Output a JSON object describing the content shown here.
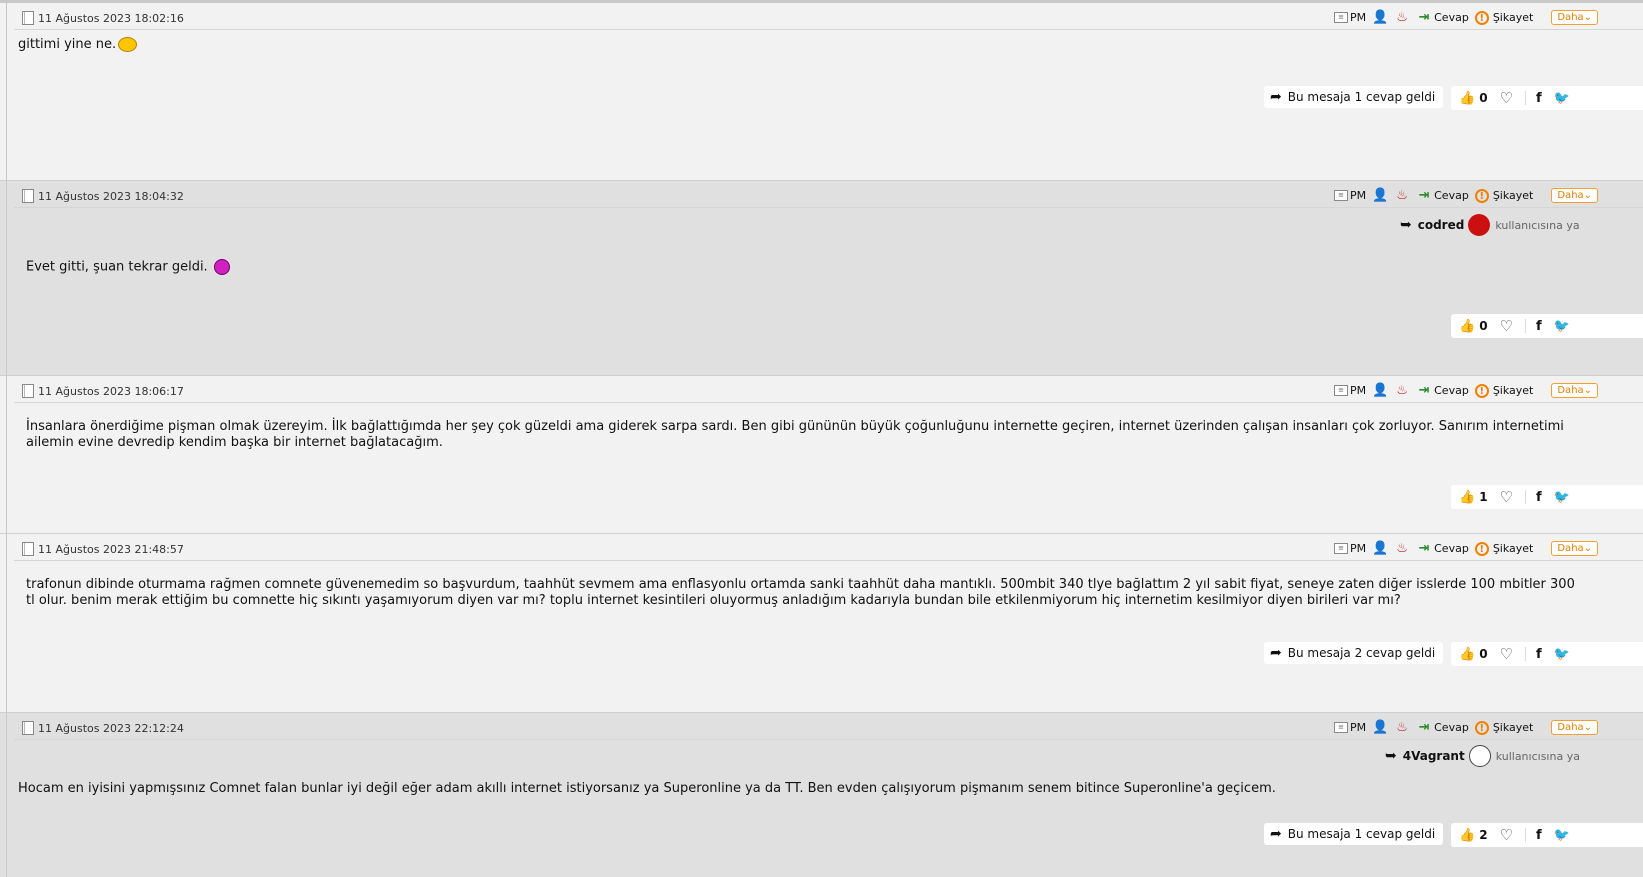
{
  "actions": {
    "pm": "PM",
    "reply": "Cevap",
    "report": "Şikayet",
    "more": "Daha"
  },
  "quote_suffix": "kullanıcısına ya",
  "posts": [
    {
      "date": "11 Ağustos 2023 18:02:16",
      "body": "gittimi yine ne.",
      "replies": "Bu mesaja 1 cevap geldi",
      "likes": "0"
    },
    {
      "date": "11 Ağustos 2023 18:04:32",
      "quoted_user": "codred",
      "body": "Evet gitti, şuan tekrar geldi.",
      "likes": "0"
    },
    {
      "date": "11 Ağustos 2023 18:06:17",
      "body": "İnsanlara önerdiğime pişman olmak üzereyim. İlk bağlattığımda her şey çok güzeldi ama giderek sarpa sardı. Ben gibi gününün büyük çoğunluğunu internette geçiren, internet üzerinden çalışan insanları çok zorluyor. Sanırım internetimi ailemin evine devredip kendim başka bir internet bağlatacağım.",
      "likes": "1"
    },
    {
      "date": "11 Ağustos 2023 21:48:57",
      "body": "trafonun dibinde oturmama rağmen comnete güvenemedim so başvurdum, taahhüt sevmem ama enflasyonlu ortamda sanki taahhüt daha mantıklı. 500mbit 340 tlye bağlattım 2 yıl sabit fiyat, seneye zaten diğer isslerde 100 mbitler 300 tl olur. benim merak ettiğim bu comnette hiç sıkıntı yaşamıyorum diyen var mı? toplu internet kesintileri oluyormuş anladığım kadarıyla bundan bile etkilenmiyorum hiç internetim kesilmiyor diyen birileri var mı?",
      "replies": "Bu mesaja 2 cevap geldi",
      "likes": "0"
    },
    {
      "date": "11 Ağustos 2023 22:12:24",
      "quoted_user": "4Vagrant",
      "body": "Hocam en iyisini yapmışsınız Comnet falan bunlar iyi değil eğer adam akıllı internet istiyorsanız ya Superonline ya da TT. Ben evden çalışıyorum pişmanım senem bitince Superonline'a geçicem.",
      "replies": "Bu mesaja 1 cevap geldi",
      "likes": "2"
    }
  ]
}
